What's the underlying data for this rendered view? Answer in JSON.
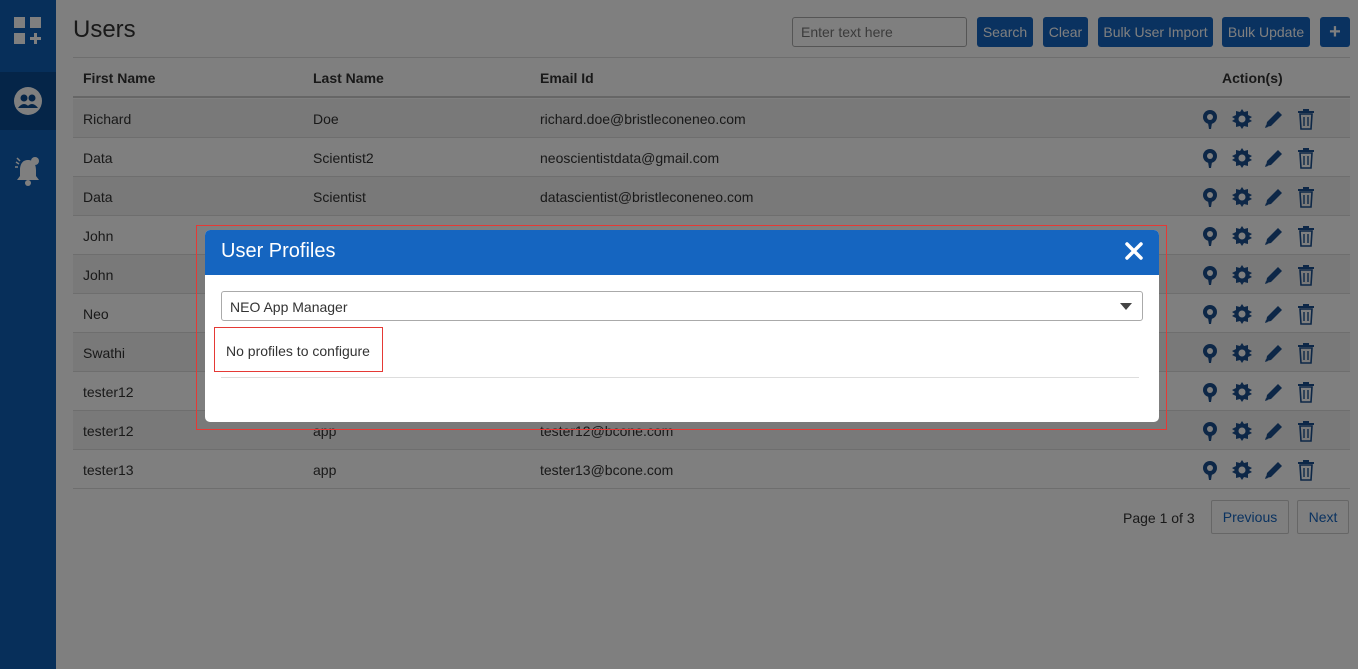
{
  "header": {
    "title": "Users",
    "search_placeholder": "Enter text here",
    "search_label": "Search",
    "clear_label": "Clear",
    "bulk_import_label": "Bulk User Import",
    "bulk_update_label": "Bulk Update",
    "add_label": "+"
  },
  "table": {
    "columns": [
      "First Name",
      "Last Name",
      "Email Id",
      "Action(s)"
    ],
    "rows": [
      {
        "first": "Richard",
        "last": "Doe",
        "email": "richard.doe@bristleconeneo.com"
      },
      {
        "first": "Data",
        "last": "Scientist2",
        "email": "neoscientistdata@gmail.com"
      },
      {
        "first": "Data",
        "last": "Scientist",
        "email": "datascientist@bristleconeneo.com"
      },
      {
        "first": "John",
        "last": "",
        "email": ""
      },
      {
        "first": "John",
        "last": "",
        "email": ""
      },
      {
        "first": "Neo",
        "last": "",
        "email": ""
      },
      {
        "first": "Swathi",
        "last": "",
        "email": ""
      },
      {
        "first": "tester12",
        "last": "",
        "email": ""
      },
      {
        "first": "tester12",
        "last": "app",
        "email": "tester12@bcone.com"
      },
      {
        "first": "tester13",
        "last": "app",
        "email": "tester13@bcone.com"
      }
    ]
  },
  "pager": {
    "text": "Page 1 of 3",
    "previous_label": "Previous",
    "next_label": "Next"
  },
  "modal": {
    "title": "User Profiles",
    "selected_app": "NEO App Manager",
    "empty_message": "No profiles to configure"
  },
  "colors": {
    "primary": "#1565c0",
    "sidebar": "#0f5fb5",
    "icon": "#1a4f8e",
    "highlight": "#e53935"
  },
  "icons": {
    "sidebar": [
      "dashboard-add-icon",
      "users-group-icon",
      "notification-bell-icon"
    ],
    "row_actions": [
      "user-profile-icon",
      "settings-gear-icon",
      "edit-pencil-icon",
      "delete-trash-icon"
    ],
    "modal_close": "close-icon"
  }
}
